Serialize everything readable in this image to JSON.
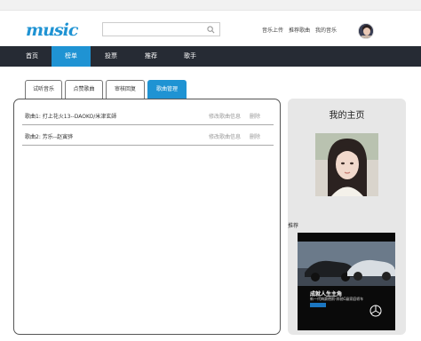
{
  "header": {
    "logo_text": "MUSIC",
    "search": {
      "placeholder": "",
      "value": ""
    },
    "links": [
      "音乐上传",
      "推荐歌曲",
      "我的音乐"
    ]
  },
  "nav": {
    "items": [
      "首页",
      "榜单",
      "投票",
      "推荐",
      "歌手"
    ],
    "active": "榜单"
  },
  "tabs": {
    "items": [
      "试听音乐",
      "点赞歌曲",
      "审核回复",
      "歌曲管理"
    ],
    "active": "歌曲管理"
  },
  "songs": [
    {
      "title": "歌曲1: 打上花火13--DAOKO/米津玄師",
      "edit": "修改歌曲信息",
      "delete": "删除"
    },
    {
      "title": "歌曲2: 芳乐--赵寅骅",
      "edit": "修改歌曲信息",
      "delete": "删除"
    }
  ],
  "sidebar": {
    "title": "我的主页",
    "recommend_label": "推荐",
    "ad": {
      "headline": "成就人生主角",
      "subline": "新一代梅赛德斯-奔驰C级家庭轿车"
    }
  },
  "colors": {
    "accent": "#1f93d3",
    "navbar": "#262b34",
    "panel": "#e7e7e7"
  }
}
